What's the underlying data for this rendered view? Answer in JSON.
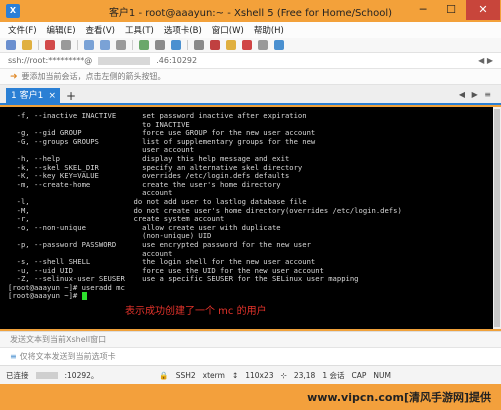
{
  "window": {
    "title": "客户1 - root@aaayun:~ - Xshell 5 (Free for Home/School)",
    "app_icon_letter": "X",
    "minimize": "─",
    "maximize": "☐",
    "close": "✕"
  },
  "menu": [
    "文件(F)",
    "编辑(E)",
    "查看(V)",
    "工具(T)",
    "选项卡(B)",
    "窗口(W)",
    "帮助(H)"
  ],
  "address": {
    "prefix": "ssh://root:*********@",
    "suffix": ".46:10292",
    "nav": "◀ ▶"
  },
  "hint": "要添加当前会话，点击左侧的箭头按钮。",
  "tabs": {
    "active_label": "1 客户1",
    "close": "×",
    "add": "+",
    "nav": "◀ ▶ ≡"
  },
  "terminal_lines": [
    "  -f, --inactive INACTIVE      set password inactive after expiration",
    "                               to INACTIVE",
    "  -g, --gid GROUP              force use GROUP for the new user account",
    "  -G, --groups GROUPS          list of supplementary groups for the new",
    "                               user account",
    "  -h, --help                   display this help message and exit",
    "  -k, --skel SKEL_DIR          specify an alternative skel directory",
    "  -K, --key KEY=VALUE          overrides /etc/login.defs defaults",
    "  -m, --create-home            create the user's home directory",
    "                               account",
    "  -l,                        do not add user to lastlog database file",
    "  -M,                        do not create user's home directory(overrides /etc/login.defs)",
    "  -r,                        create system account",
    "  -o, --non-unique             allow create user with duplicate",
    "                               (non-unique) UID",
    "  -p, --password PASSWORD      use encrypted password for the new user",
    "                               account",
    "  -s, --shell SHELL            the login shell for the new user account",
    "  -u, --uid UID                force use the UID for the new user account",
    "  -Z, --selinux-user SEUSER    use a specific SEUSER for the SELinux user mapping",
    "",
    "[root@aaayun ~]# useradd mc",
    "[root@aaayun ~]# "
  ],
  "annotation": "表示成功创建了一个 mc 的用户",
  "send_bar": "发送文本到当前Xshell窗口",
  "compose_bar": "仅将文本发送到当前选项卡",
  "status": {
    "left": "已连接",
    "port": ":10292。",
    "protocol": "SSH2",
    "terminal": "xterm",
    "size": "110x23",
    "position": "23,18",
    "sessions": "1 会话",
    "caps": "CAP",
    "num": "NUM"
  },
  "watermark": "www.vipcn.com[清风手游网]提供",
  "colors": {
    "titlebar": "#f3a13a",
    "tab_accent": "#2a7fd4",
    "cursor": "#2de02d",
    "annotation": "#e4332b",
    "close_button": "#c8453b"
  }
}
